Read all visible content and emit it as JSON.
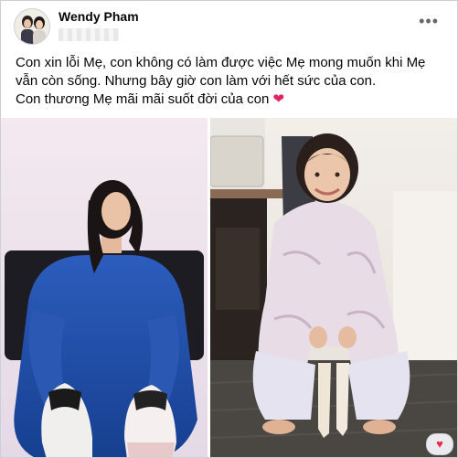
{
  "post": {
    "author": "Wendy Pham",
    "more_icon": "more-horizontal-icon",
    "caption_lines": [
      "Con xin lỗi Mẹ, con không có làm được việc Mẹ mong muốn khi Mẹ",
      "vẫn còn sống. Nhưng bây giờ con làm với hết sức của con.",
      "Con thương Mẹ mãi mãi suốt đời của con"
    ],
    "emoji": "❤"
  },
  "colors": {
    "text": "#050505",
    "secondary": "#65676b",
    "dress_blue": "#1f4fa8",
    "heart": "#e0245e"
  }
}
